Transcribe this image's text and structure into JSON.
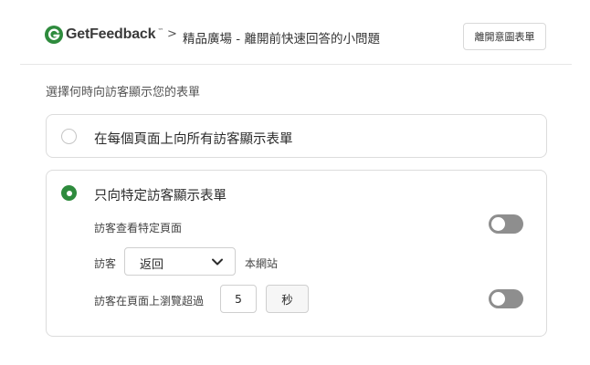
{
  "header": {
    "logo_text": "GetFeedback",
    "logo_tm": "™",
    "breadcrumb_separator": ">",
    "title": "精品廣場 - 離開前快速回答的小問題",
    "exit_button_label": "離開意圖表單"
  },
  "prompt": "選擇何時向訪客顯示您的表單",
  "options": [
    {
      "label": "在每個頁面上向所有訪客顯示表單",
      "selected": false
    },
    {
      "label": "只向特定訪客顯示表單",
      "selected": true
    }
  ],
  "conditions": {
    "specific_page_label": "訪客查看特定頁面",
    "specific_page_enabled": false,
    "visitor_prefix": "訪客",
    "visitor_select_value": "返回",
    "visitor_suffix": "本網站",
    "browse_label": "訪客在頁面上瀏覽超過",
    "browse_value": "5",
    "browse_unit": "秒",
    "browse_enabled": false
  },
  "colors": {
    "brand_green": "#2e8b3d",
    "toggle_off": "#8e8e8e"
  },
  "icons": {
    "logo": "getfeedback-logo-icon",
    "select_chevron": "chevron-down-icon"
  }
}
